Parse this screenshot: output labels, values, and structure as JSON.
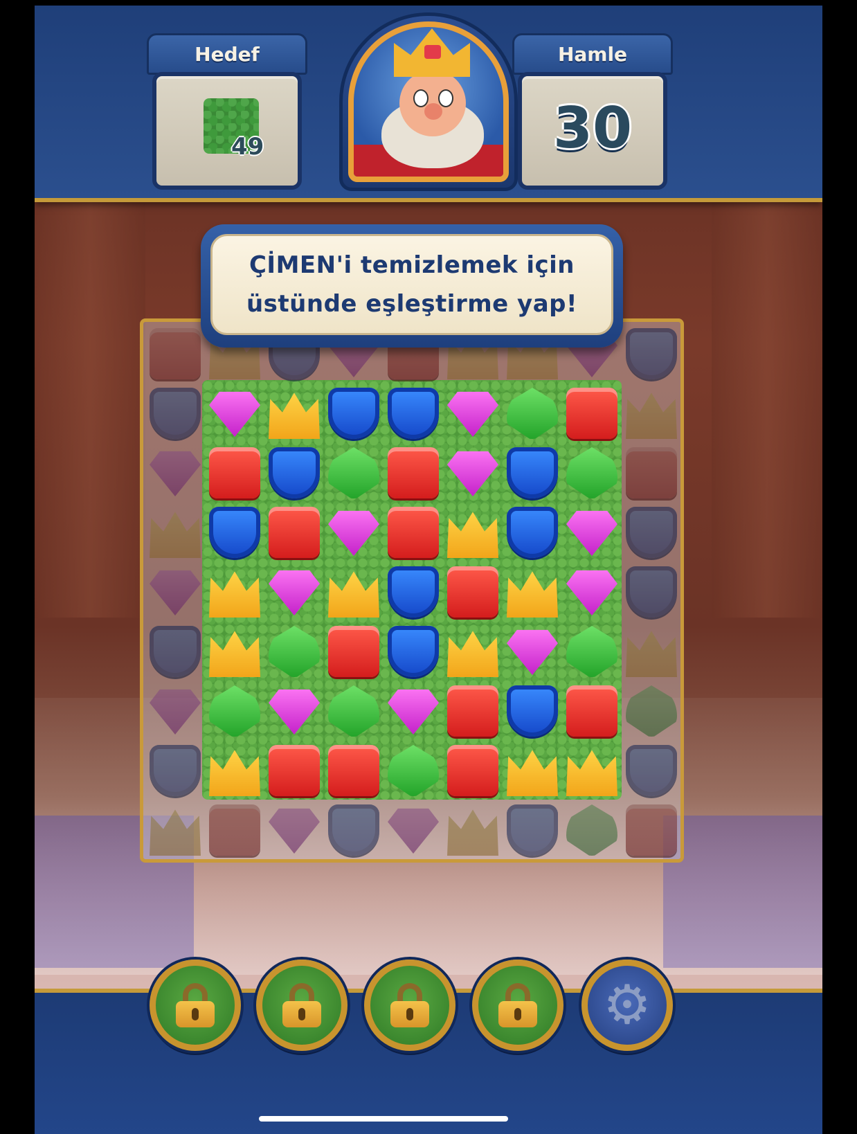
{
  "header": {
    "goal_label": "Hedef",
    "goal_count": "49",
    "goal_icon": "grass-icon",
    "moves_label": "Hamle",
    "moves_count": "30"
  },
  "tooltip": {
    "line1": "ÇİMEN'i temizlemek için",
    "line2": "üstünde eşleştirme yap!"
  },
  "board": {
    "rows": [
      [
        "red",
        "yellow",
        "blue",
        "purple",
        "red",
        "yellow",
        "yellow",
        "purple",
        "blue"
      ],
      [
        "blue",
        "purple",
        "yellow",
        "blue",
        "blue",
        "purple",
        "green",
        "red",
        "yellow"
      ],
      [
        "purple",
        "red",
        "blue",
        "green",
        "red",
        "purple",
        "blue",
        "green",
        "red"
      ],
      [
        "yellow",
        "blue",
        "red",
        "purple",
        "red",
        "yellow",
        "blue",
        "purple",
        "blue"
      ],
      [
        "purple",
        "yellow",
        "purple",
        "yellow",
        "blue",
        "red",
        "yellow",
        "purple",
        "blue"
      ],
      [
        "blue",
        "yellow",
        "green",
        "red",
        "blue",
        "yellow",
        "purple",
        "green",
        "yellow"
      ],
      [
        "purple",
        "green",
        "purple",
        "green",
        "purple",
        "red",
        "blue",
        "red",
        "green"
      ],
      [
        "blue",
        "yellow",
        "red",
        "red",
        "green",
        "red",
        "yellow",
        "yellow",
        "blue"
      ],
      [
        "yellow",
        "red",
        "purple",
        "blue",
        "purple",
        "yellow",
        "blue",
        "green",
        "red"
      ]
    ]
  },
  "boosters": [
    {
      "icon": "lock-icon",
      "locked": true
    },
    {
      "icon": "lock-icon",
      "locked": true
    },
    {
      "icon": "lock-icon",
      "locked": true
    },
    {
      "icon": "lock-icon",
      "locked": true
    },
    {
      "icon": "gear-icon",
      "locked": false
    }
  ]
}
